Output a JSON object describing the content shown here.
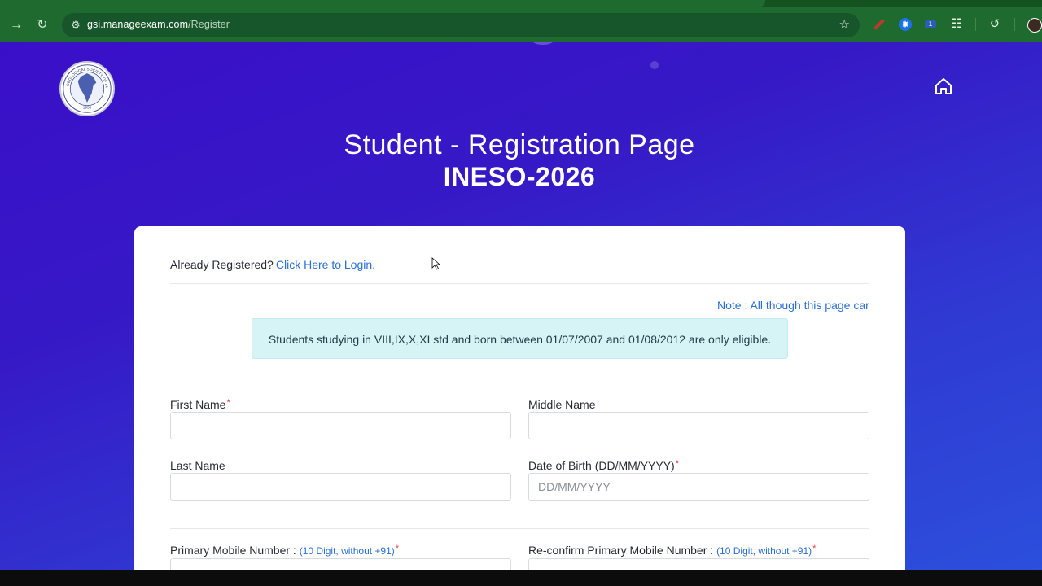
{
  "browser": {
    "url_domain": "gsi.manageexam.com",
    "url_path": "/Register"
  },
  "header": {
    "title": "Student - Registration Page",
    "subtitle": "INESO-2026",
    "logo_text": "GEOLOGICAL SOCIETY OF INDIA",
    "logo_year": "1958"
  },
  "card": {
    "already_text": "Already Registered?",
    "login_link": "Click Here to Login.",
    "note": "Note : All though this page car",
    "eligibility": "Students studying in VIII,IX,X,XI std and born between 01/07/2007 and 01/08/2012 are only eligible.",
    "fields": {
      "first_name": {
        "label": "First Name",
        "required": "*",
        "value": ""
      },
      "middle_name": {
        "label": "Middle Name",
        "value": ""
      },
      "last_name": {
        "label": "Last Name",
        "value": ""
      },
      "dob": {
        "label": "Date of Birth (DD/MM/YYYY)",
        "required": "*",
        "placeholder": "DD/MM/YYYY",
        "value": ""
      },
      "primary_mobile": {
        "label": "Primary Mobile Number :",
        "hint": "(10 Digit, without +91)",
        "required": "*"
      },
      "confirm_mobile": {
        "label": "Re-confirm Primary Mobile Number :",
        "hint": "(10 Digit, without +91)",
        "required": "*"
      }
    }
  },
  "icons": {
    "back": "arrow-right-icon",
    "reload": "reload-icon",
    "site_info": "tune-icon",
    "bookmark": "star-icon",
    "extensions": "puzzle-icon",
    "history": "history-icon",
    "home": "home-icon"
  },
  "colors": {
    "page_gradient_start": "#3a0fc9",
    "page_gradient_end": "#2c4fdc",
    "link": "#2a6fd6",
    "required": "#e0434d",
    "alert_bg": "#d6f3f6",
    "chrome_bg": "#1f6b2f"
  }
}
